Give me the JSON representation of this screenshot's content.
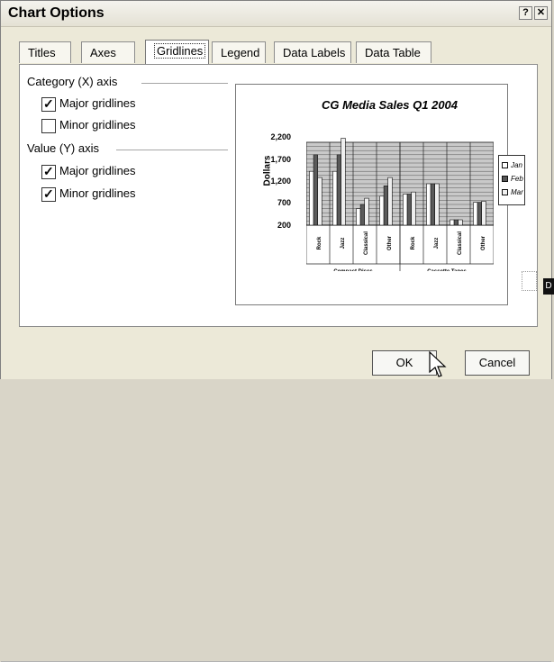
{
  "title": "Chart Options",
  "title_buttons": [
    "?",
    "✕"
  ],
  "tabs": [
    "Titles",
    "Axes",
    "Gridlines",
    "Legend",
    "Data Labels",
    "Data Table"
  ],
  "active_tab": "Gridlines",
  "category_axis": {
    "label": "Category (X) axis",
    "major": {
      "label": "Major gridlines",
      "checked": true
    },
    "minor": {
      "label": "Minor gridlines",
      "checked": false
    }
  },
  "value_axis": {
    "label": "Value (Y) axis",
    "major": {
      "label": "Major gridlines",
      "checked": true
    },
    "minor": {
      "label": "Minor gridlines",
      "checked": true
    }
  },
  "chart_data": {
    "type": "bar",
    "title": "CG Media Sales Q1 2004",
    "ylabel": "Dollars",
    "yticks": [
      "2,200",
      "1,700",
      "1,200",
      "700",
      "200"
    ],
    "categories": [
      "Rock",
      "Jazz",
      "Classical",
      "Other",
      "Rock",
      "Jazz",
      "Classical",
      "Other"
    ],
    "groups": [
      "Compact Discs",
      "Cassette Tapes"
    ],
    "series": [
      {
        "name": "Jan",
        "values": [
          1500,
          1500,
          600,
          900,
          950,
          1200,
          330,
          750
        ]
      },
      {
        "name": "Feb",
        "values": [
          1900,
          1900,
          700,
          1150,
          950,
          1200,
          330,
          750
        ]
      },
      {
        "name": "Mar",
        "values": [
          1350,
          2300,
          850,
          1350,
          1000,
          1200,
          330,
          780
        ]
      }
    ],
    "ylim": [
      200,
      2200
    ],
    "grid": "on",
    "legend": "right"
  },
  "buttons": {
    "ok": "OK",
    "cancel": "Cancel"
  },
  "side_label": "D"
}
